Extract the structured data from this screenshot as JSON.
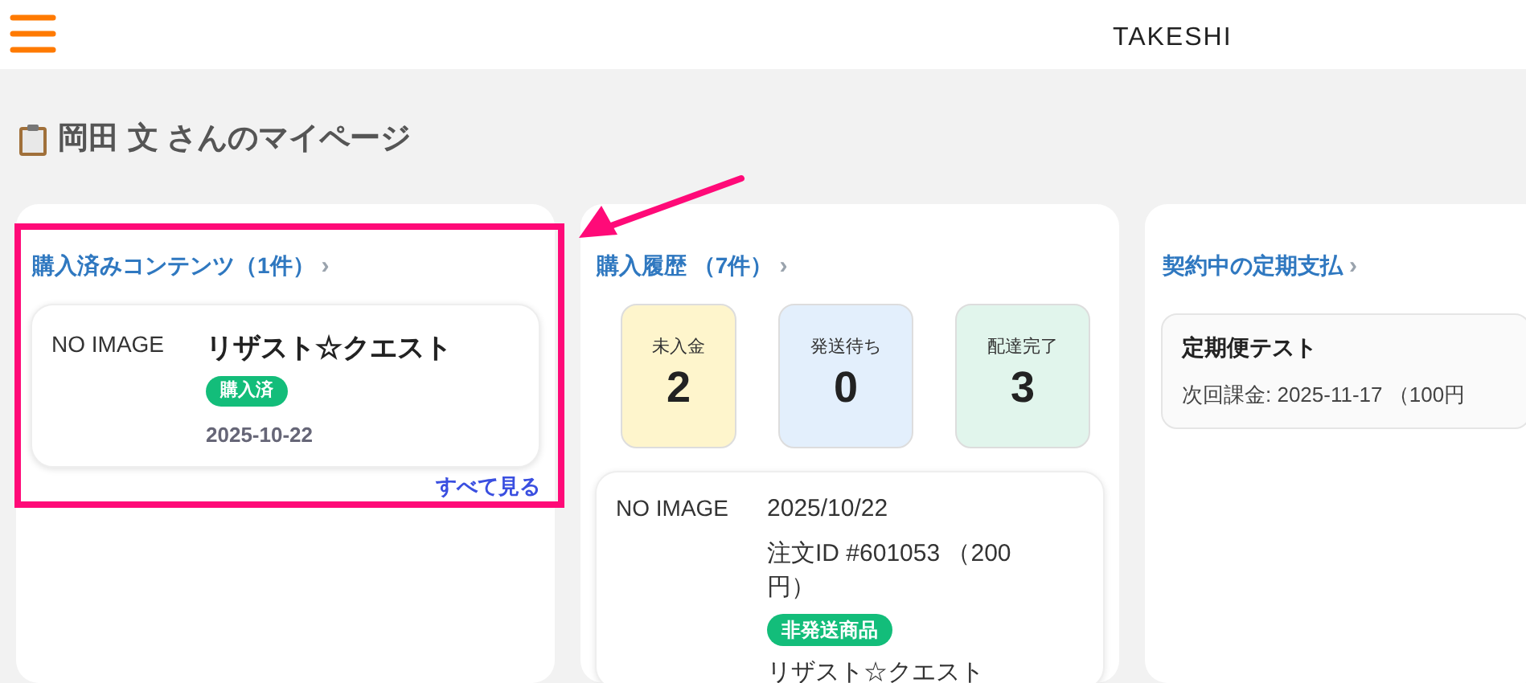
{
  "header": {
    "brand": "TAKESHI"
  },
  "page_title": "岡田 文 さんのマイページ",
  "purchased_contents": {
    "heading": "購入済みコンテンツ（1件）",
    "chevron": "›",
    "items": [
      {
        "image": "NO IMAGE",
        "name": "リザスト☆クエスト",
        "badge": "購入済",
        "date": "2025-10-22"
      }
    ],
    "see_all": "すべて見る"
  },
  "purchase_history": {
    "heading": "購入履歴 （7件）",
    "chevron": "›",
    "status_counts": [
      {
        "label": "未入金",
        "count": "2",
        "color": "#fef5cc"
      },
      {
        "label": "発送待ち",
        "count": "0",
        "color": "#e3effc"
      },
      {
        "label": "配達完了",
        "count": "3",
        "color": "#e1f5ec"
      }
    ],
    "orders": [
      {
        "image": "NO IMAGE",
        "date": "2025/10/22",
        "order_line": "注文ID #601053 （200円）",
        "badge": "非発送商品",
        "name": "リザスト☆クエスト"
      }
    ]
  },
  "subscriptions": {
    "heading": "契約中の定期支払",
    "chevron": "›",
    "items": [
      {
        "name": "定期便テスト",
        "next_charge": "次回課金: 2025-11-17 （100円"
      }
    ]
  },
  "annotation": {
    "highlight": true,
    "arrow": true
  }
}
